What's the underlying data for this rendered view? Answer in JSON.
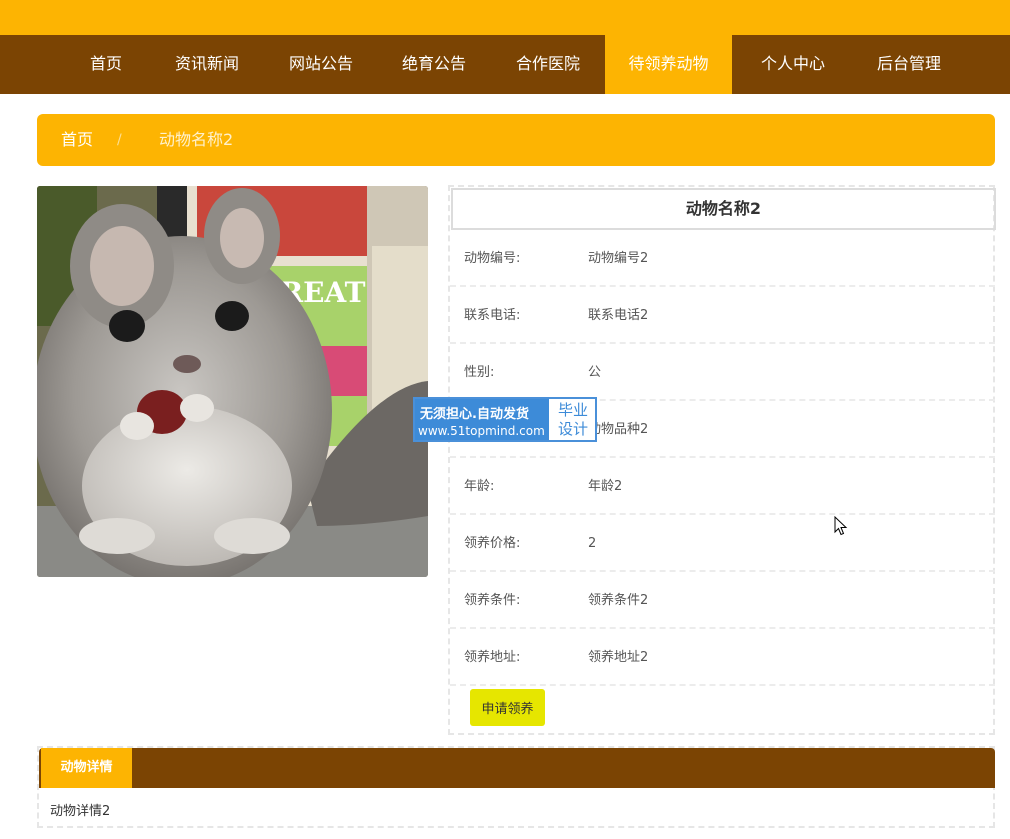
{
  "nav": {
    "items": [
      {
        "label": "首页"
      },
      {
        "label": "资讯新闻"
      },
      {
        "label": "网站公告"
      },
      {
        "label": "绝育公告"
      },
      {
        "label": "合作医院"
      },
      {
        "label": "待领养动物",
        "active": true
      },
      {
        "label": "个人中心"
      },
      {
        "label": "后台管理"
      }
    ]
  },
  "breadcrumb": {
    "home": "首页",
    "separator": "/",
    "current": "动物名称2"
  },
  "detail": {
    "title": "动物名称2",
    "fields": [
      {
        "label": "动物编号:",
        "value": "动物编号2"
      },
      {
        "label": "联系电话:",
        "value": "联系电话2"
      },
      {
        "label": "性别:",
        "value": "公"
      },
      {
        "label": "",
        "value": "动物品种2"
      },
      {
        "label": "年龄:",
        "value": "年龄2"
      },
      {
        "label": "领养价格:",
        "value": "2"
      },
      {
        "label": "领养条件:",
        "value": "领养条件2"
      },
      {
        "label": "领养地址:",
        "value": "领养地址2"
      }
    ],
    "apply_button": "申请领养"
  },
  "watermark": {
    "line1": "无须担心.自动发货",
    "line2": "www.51topmind.com",
    "badge_line1": "毕业",
    "badge_line2": "设计"
  },
  "tabs": {
    "detail_tab": "动物详情",
    "detail_content": "动物详情2"
  },
  "photo": {
    "text": "TREATS"
  },
  "colors": {
    "accent_yellow": "#FDB402",
    "nav_brown": "#7B4403",
    "button_yellow": "#E6E600",
    "watermark_blue": "#3D8BD8"
  }
}
